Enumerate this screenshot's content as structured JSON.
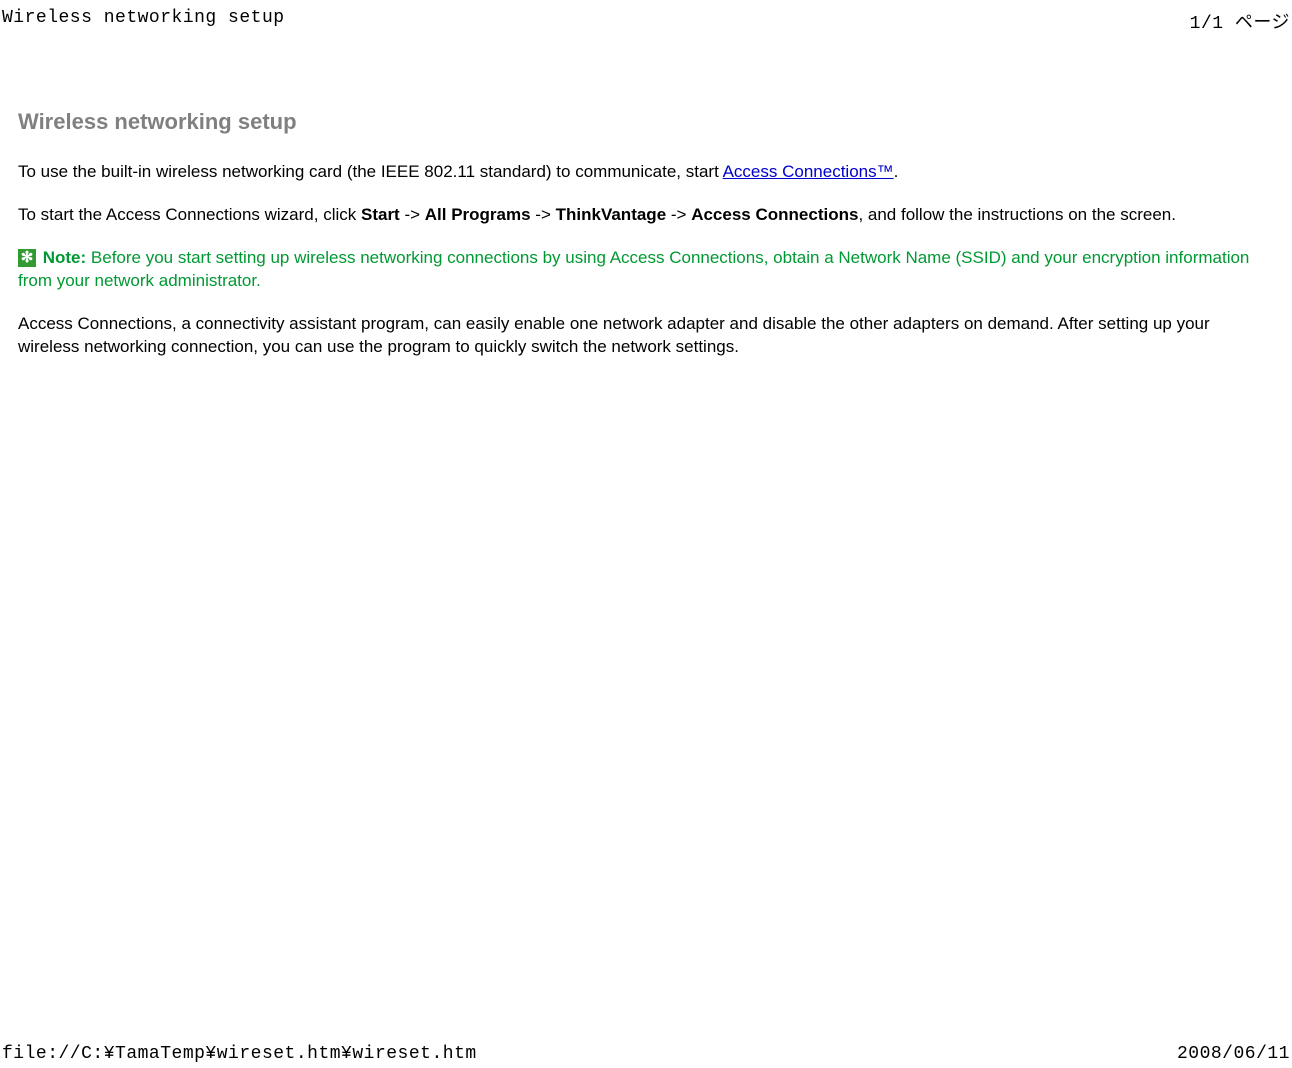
{
  "header": {
    "title_left": "Wireless networking setup",
    "page_indicator": "1/1 ページ"
  },
  "content": {
    "title": "Wireless networking setup",
    "p1_a": "To use the built-in wireless networking card (the IEEE 802.11 standard) to communicate, start ",
    "p1_link": "Access Connections™",
    "p1_b": ".",
    "p2_a": "To start the Access Connections wizard, click ",
    "p2_start": "Start",
    "p2_arrow1": " -> ",
    "p2_allprograms": "All Programs",
    "p2_arrow2": " -> ",
    "p2_thinkvantage": "ThinkVantage",
    "p2_arrow3": " -> ",
    "p2_accessconn": "Access Connections",
    "p2_tail": ", and follow the instructions on the screen.",
    "note_icon_glyph": "✻",
    "note_label": "Note:",
    "note_text": " Before you start setting up wireless networking connections by using Access Connections, obtain a Network Name (SSID) and your encryption information from your network administrator.",
    "p3": "Access Connections, a connectivity assistant program, can easily enable one network adapter and disable the other adapters on demand. After setting up your wireless networking connection, you can use the program to quickly switch the network settings."
  },
  "footer": {
    "path": "file://C:¥TamaTemp¥wireset.htm¥wireset.htm",
    "date": "2008/06/11"
  }
}
